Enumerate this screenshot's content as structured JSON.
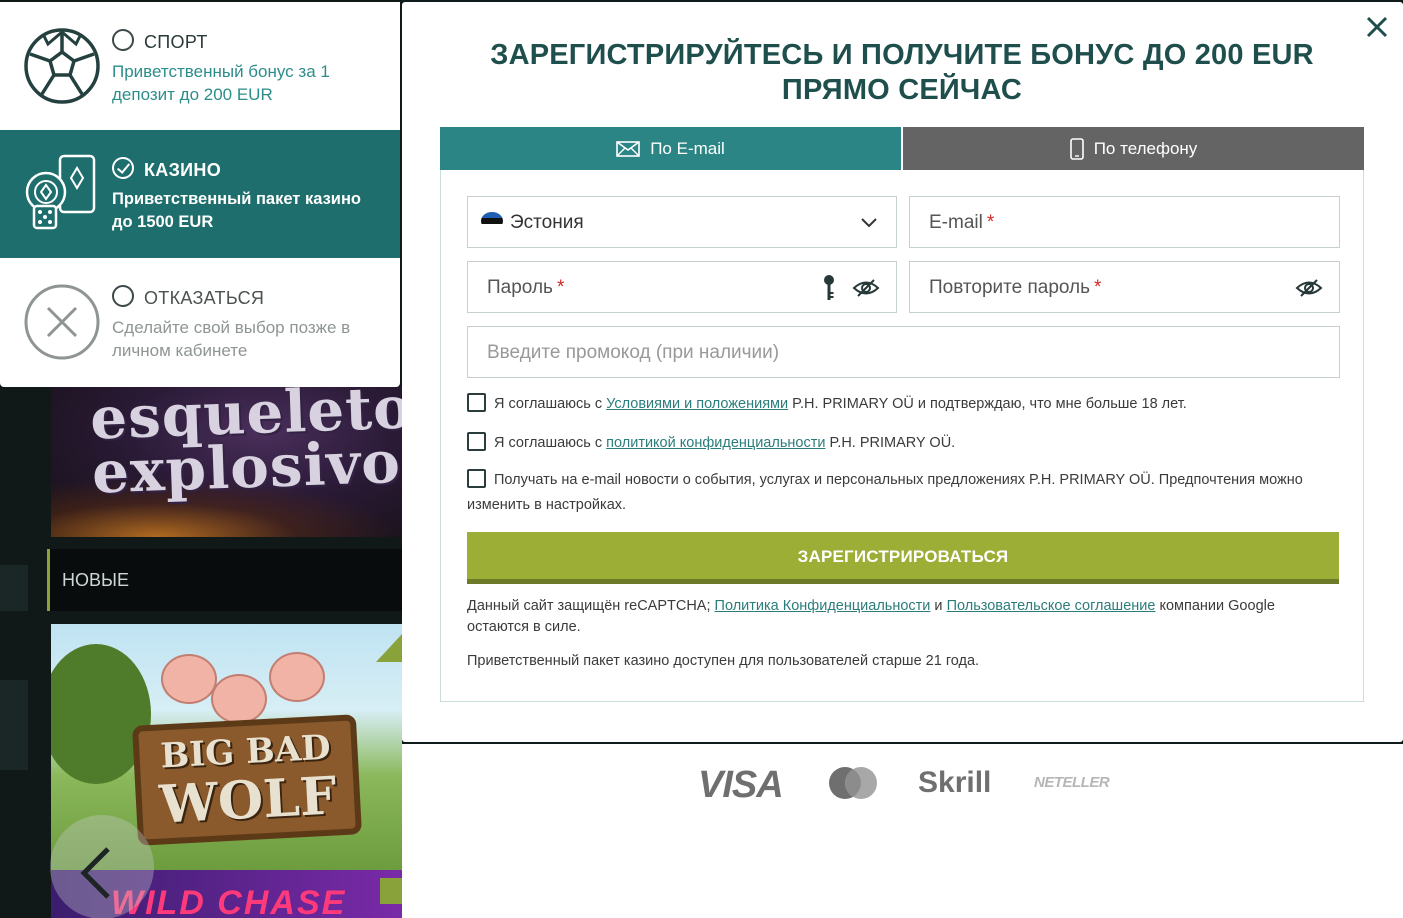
{
  "background": {
    "tile1_title": "esqueleto explosivo",
    "section_label": "НОВЫЕ",
    "tile2_title_line1": "BIG BAD",
    "tile2_title_line2": "WOLF",
    "tile3_title": "WILD CHASE"
  },
  "bonus": {
    "options": [
      {
        "title": "СПОРТ",
        "description": "Приветственный бонус за 1 депозит до 200 EUR",
        "icon": "soccer-ball-icon",
        "selected": false
      },
      {
        "title": "КАЗИНО",
        "description": "Приветственный пакет казино до 1500 EUR",
        "icon": "casino-chips-icon",
        "selected": true
      },
      {
        "title": "ОТКАЗАТЬСЯ",
        "description": "Сделайте свой выбор позже в личном кабинете",
        "icon": "decline-x-icon",
        "selected": false
      }
    ]
  },
  "modal": {
    "title": "ЗАРЕГИСТРИРУЙТЕСЬ И ПОЛУЧИТЕ БОНУС ДО 200 EUR ПРЯМО СЕЙЧАС",
    "tabs": [
      {
        "label": "По E-mail",
        "icon": "envelope-icon",
        "active": true
      },
      {
        "label": "По телефону",
        "icon": "phone-icon",
        "active": false
      }
    ],
    "fields": {
      "country": {
        "value": "Эстония",
        "flag": "estonia-flag"
      },
      "email": {
        "placeholder": "E-mail",
        "required_mark": "*"
      },
      "password": {
        "placeholder": "Пароль",
        "required_mark": "*"
      },
      "password_repeat": {
        "placeholder": "Повторите пароль",
        "required_mark": "*"
      },
      "promo": {
        "placeholder": "Введите промокод (при наличии)"
      }
    },
    "checks": {
      "terms": {
        "prefix": "Я соглашаюсь с ",
        "link": "Условиями и положениями",
        "suffix": " P.H. PRIMARY OÜ и подтверждаю, что мне больше 18 лет."
      },
      "privacy": {
        "prefix": "Я соглашаюсь с ",
        "link": "политикой конфиденциальности",
        "suffix": " P.H. PRIMARY OÜ."
      },
      "news": {
        "text": "Получать на e-mail новости о события, услугах и персональных предложениях P.H. PRIMARY OÜ. Предпочтения можно изменить в настройках."
      }
    },
    "submit_label": "ЗАРЕГИСТРИРОВАТЬСЯ",
    "recaptcha": {
      "prefix": "Данный сайт защищён reCAPTCHA; ",
      "link1": "Политика Конфиденциальности",
      "middle": " и ",
      "link2": "Пользовательское соглашение",
      "suffix": " компании Google остаются в силе."
    },
    "age_note": "Приветственный пакет казино доступен для пользователей старше 21 года."
  },
  "payments": {
    "visa": "VISA",
    "skrill": "Skrill",
    "neteller": "NETELLER"
  },
  "colors": {
    "brand_teal": "#1d6e6c",
    "tab_active": "#2b8584",
    "tab_inactive": "#646464",
    "submit": "#9dae36",
    "heading": "#1f4f4d"
  }
}
